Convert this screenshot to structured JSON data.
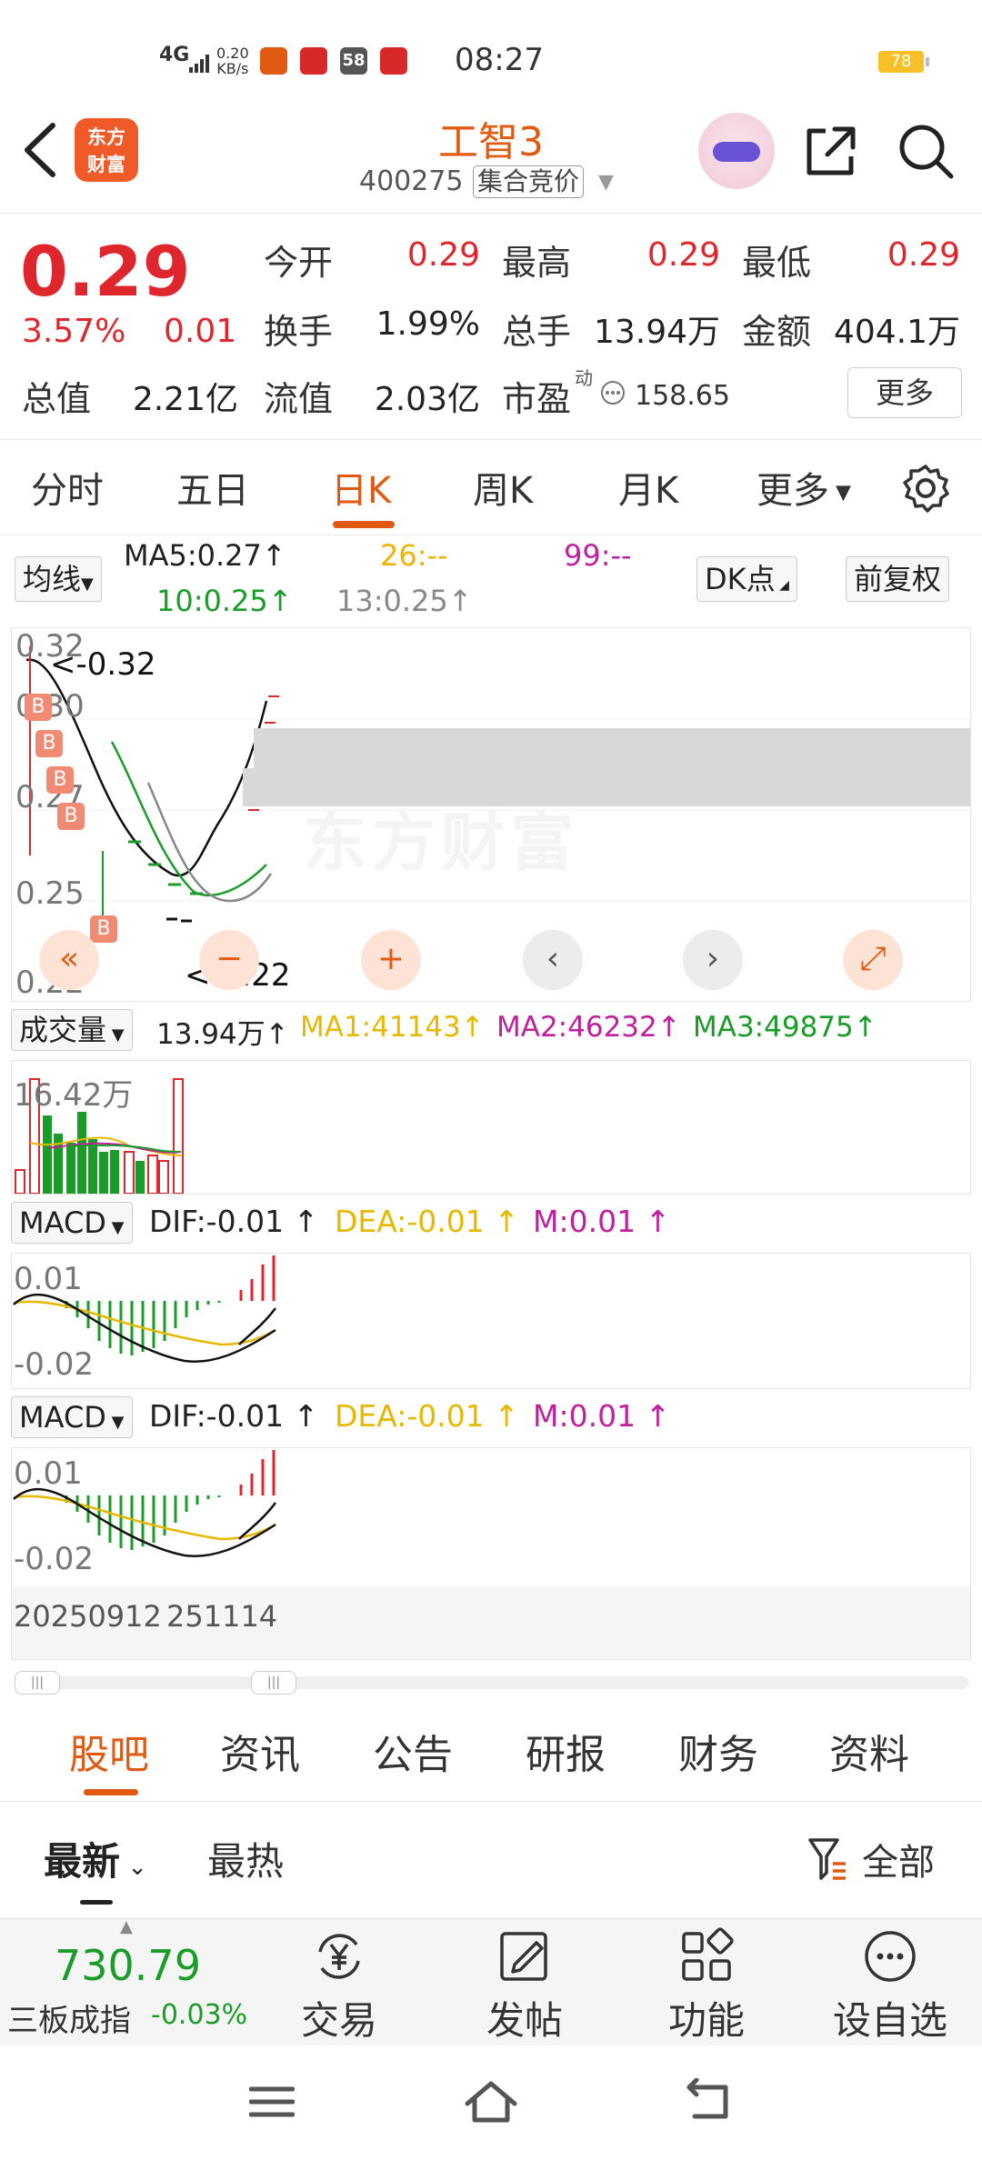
{
  "status_bar": {
    "network": "4G",
    "speed": "0.20",
    "speed_unit": "KB/s",
    "app_badge": "58",
    "time": "08:27",
    "battery": "78"
  },
  "header": {
    "logo_line1": "东方",
    "logo_line2": "财富",
    "stock_name": "工智3",
    "stock_code": "400275",
    "auction_tag": "集合竞价"
  },
  "quote": {
    "price": "0.29",
    "change_pct": "3.57%",
    "change": "0.01",
    "fields": [
      {
        "label": "今开",
        "value": "0.29",
        "color": "#e0262d"
      },
      {
        "label": "最高",
        "value": "0.29",
        "color": "#e0262d"
      },
      {
        "label": "最低",
        "value": "0.29",
        "color": "#e0262d"
      },
      {
        "label": "换手",
        "value": "1.99%",
        "color": "#222222"
      },
      {
        "label": "总手",
        "value": "13.94万",
        "color": "#222222"
      },
      {
        "label": "金额",
        "value": "404.1万",
        "color": "#222222"
      },
      {
        "label": "总值",
        "value": "2.21亿",
        "color": "#222222"
      },
      {
        "label": "流值",
        "value": "2.03亿",
        "color": "#222222"
      },
      {
        "label": "市盈",
        "value": "158.65",
        "color": "#222222"
      }
    ],
    "pe_superscript": "动",
    "more_label": "更多"
  },
  "period_tabs": [
    "分时",
    "五日",
    "日K",
    "周K",
    "月K",
    "更多"
  ],
  "active_period": "日K",
  "ma_row": {
    "indicator_label": "均线",
    "ma5": "MA5:0.27",
    "ma26": "26:--",
    "ma99": "99:--",
    "ma10": "10:0.25",
    "ma13": "13:0.25",
    "dk_label": "DK点",
    "adjust_label": "前复权"
  },
  "kline": {
    "y_ticks": [
      "0.32",
      "0.30",
      "0.27",
      "0.25",
      "0.22"
    ],
    "high_label": "<-0.32",
    "low_label": "<-0.22",
    "b_marker": "B",
    "watermark": "东方财富",
    "controls": [
      "«",
      "−",
      "+",
      "‹",
      "›",
      "⤢"
    ]
  },
  "volume": {
    "indicator_label": "成交量",
    "value": "13.94万",
    "ma1": "MA1:41143",
    "ma2": "MA2:46232",
    "ma3": "MA3:49875",
    "max_label": "16.42万"
  },
  "macd1": {
    "indicator_label": "MACD",
    "dif": "DIF:-0.01",
    "dea": "DEA:-0.01",
    "m": "M:0.01",
    "top_label": "0.01",
    "bottom_label": "-0.02"
  },
  "macd2": {
    "indicator_label": "MACD",
    "dif": "DIF:-0.01",
    "dea": "DEA:-0.01",
    "m": "M:0.01",
    "top_label": "0.01",
    "bottom_label": "-0.02"
  },
  "date_range": "20250912",
  "date_range_overlap": "251114",
  "section_tabs": [
    "股吧",
    "资讯",
    "公告",
    "研报",
    "财务",
    "资料"
  ],
  "active_section": "股吧",
  "sort": {
    "latest": "最新",
    "hot": "最热",
    "filter_label": "全部"
  },
  "bottom_bar": {
    "index_value": "730.79",
    "index_name": "三板成指",
    "index_change": "-0.03%",
    "items": [
      "交易",
      "发帖",
      "功能",
      "设自选"
    ]
  },
  "colors": {
    "up": "#e0262d",
    "down": "#1a9c28",
    "accent": "#e05a12",
    "ma5": "#222222",
    "ma10": "#1a9c28",
    "ma13": "#888888",
    "ma26": "#f0b400",
    "ma99": "#c0209c",
    "dea": "#e6b800",
    "m": "#c0209c"
  }
}
